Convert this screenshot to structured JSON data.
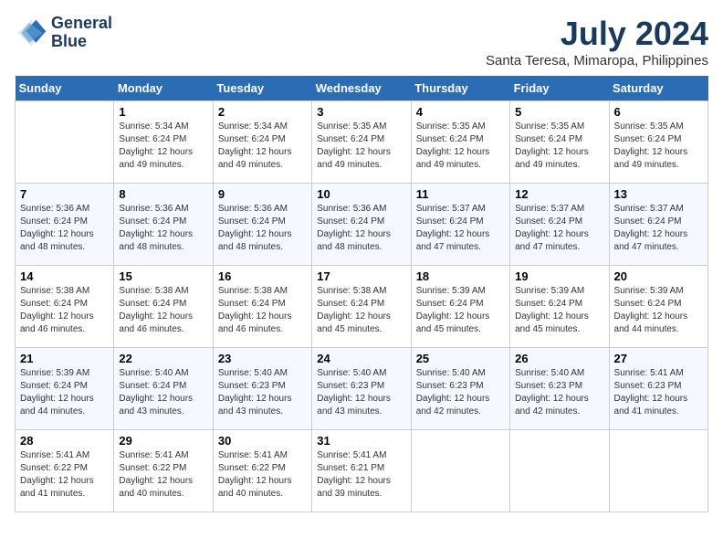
{
  "header": {
    "logo_line1": "General",
    "logo_line2": "Blue",
    "month_year": "July 2024",
    "location": "Santa Teresa, Mimaropa, Philippines"
  },
  "days_of_week": [
    "Sunday",
    "Monday",
    "Tuesday",
    "Wednesday",
    "Thursday",
    "Friday",
    "Saturday"
  ],
  "weeks": [
    [
      {
        "day": "",
        "info": ""
      },
      {
        "day": "1",
        "info": "Sunrise: 5:34 AM\nSunset: 6:24 PM\nDaylight: 12 hours\nand 49 minutes."
      },
      {
        "day": "2",
        "info": "Sunrise: 5:34 AM\nSunset: 6:24 PM\nDaylight: 12 hours\nand 49 minutes."
      },
      {
        "day": "3",
        "info": "Sunrise: 5:35 AM\nSunset: 6:24 PM\nDaylight: 12 hours\nand 49 minutes."
      },
      {
        "day": "4",
        "info": "Sunrise: 5:35 AM\nSunset: 6:24 PM\nDaylight: 12 hours\nand 49 minutes."
      },
      {
        "day": "5",
        "info": "Sunrise: 5:35 AM\nSunset: 6:24 PM\nDaylight: 12 hours\nand 49 minutes."
      },
      {
        "day": "6",
        "info": "Sunrise: 5:35 AM\nSunset: 6:24 PM\nDaylight: 12 hours\nand 49 minutes."
      }
    ],
    [
      {
        "day": "7",
        "info": "Sunrise: 5:36 AM\nSunset: 6:24 PM\nDaylight: 12 hours\nand 48 minutes."
      },
      {
        "day": "8",
        "info": "Sunrise: 5:36 AM\nSunset: 6:24 PM\nDaylight: 12 hours\nand 48 minutes."
      },
      {
        "day": "9",
        "info": "Sunrise: 5:36 AM\nSunset: 6:24 PM\nDaylight: 12 hours\nand 48 minutes."
      },
      {
        "day": "10",
        "info": "Sunrise: 5:36 AM\nSunset: 6:24 PM\nDaylight: 12 hours\nand 48 minutes."
      },
      {
        "day": "11",
        "info": "Sunrise: 5:37 AM\nSunset: 6:24 PM\nDaylight: 12 hours\nand 47 minutes."
      },
      {
        "day": "12",
        "info": "Sunrise: 5:37 AM\nSunset: 6:24 PM\nDaylight: 12 hours\nand 47 minutes."
      },
      {
        "day": "13",
        "info": "Sunrise: 5:37 AM\nSunset: 6:24 PM\nDaylight: 12 hours\nand 47 minutes."
      }
    ],
    [
      {
        "day": "14",
        "info": "Sunrise: 5:38 AM\nSunset: 6:24 PM\nDaylight: 12 hours\nand 46 minutes."
      },
      {
        "day": "15",
        "info": "Sunrise: 5:38 AM\nSunset: 6:24 PM\nDaylight: 12 hours\nand 46 minutes."
      },
      {
        "day": "16",
        "info": "Sunrise: 5:38 AM\nSunset: 6:24 PM\nDaylight: 12 hours\nand 46 minutes."
      },
      {
        "day": "17",
        "info": "Sunrise: 5:38 AM\nSunset: 6:24 PM\nDaylight: 12 hours\nand 45 minutes."
      },
      {
        "day": "18",
        "info": "Sunrise: 5:39 AM\nSunset: 6:24 PM\nDaylight: 12 hours\nand 45 minutes."
      },
      {
        "day": "19",
        "info": "Sunrise: 5:39 AM\nSunset: 6:24 PM\nDaylight: 12 hours\nand 45 minutes."
      },
      {
        "day": "20",
        "info": "Sunrise: 5:39 AM\nSunset: 6:24 PM\nDaylight: 12 hours\nand 44 minutes."
      }
    ],
    [
      {
        "day": "21",
        "info": "Sunrise: 5:39 AM\nSunset: 6:24 PM\nDaylight: 12 hours\nand 44 minutes."
      },
      {
        "day": "22",
        "info": "Sunrise: 5:40 AM\nSunset: 6:24 PM\nDaylight: 12 hours\nand 43 minutes."
      },
      {
        "day": "23",
        "info": "Sunrise: 5:40 AM\nSunset: 6:23 PM\nDaylight: 12 hours\nand 43 minutes."
      },
      {
        "day": "24",
        "info": "Sunrise: 5:40 AM\nSunset: 6:23 PM\nDaylight: 12 hours\nand 43 minutes."
      },
      {
        "day": "25",
        "info": "Sunrise: 5:40 AM\nSunset: 6:23 PM\nDaylight: 12 hours\nand 42 minutes."
      },
      {
        "day": "26",
        "info": "Sunrise: 5:40 AM\nSunset: 6:23 PM\nDaylight: 12 hours\nand 42 minutes."
      },
      {
        "day": "27",
        "info": "Sunrise: 5:41 AM\nSunset: 6:23 PM\nDaylight: 12 hours\nand 41 minutes."
      }
    ],
    [
      {
        "day": "28",
        "info": "Sunrise: 5:41 AM\nSunset: 6:22 PM\nDaylight: 12 hours\nand 41 minutes."
      },
      {
        "day": "29",
        "info": "Sunrise: 5:41 AM\nSunset: 6:22 PM\nDaylight: 12 hours\nand 40 minutes."
      },
      {
        "day": "30",
        "info": "Sunrise: 5:41 AM\nSunset: 6:22 PM\nDaylight: 12 hours\nand 40 minutes."
      },
      {
        "day": "31",
        "info": "Sunrise: 5:41 AM\nSunset: 6:21 PM\nDaylight: 12 hours\nand 39 minutes."
      },
      {
        "day": "",
        "info": ""
      },
      {
        "day": "",
        "info": ""
      },
      {
        "day": "",
        "info": ""
      }
    ]
  ]
}
